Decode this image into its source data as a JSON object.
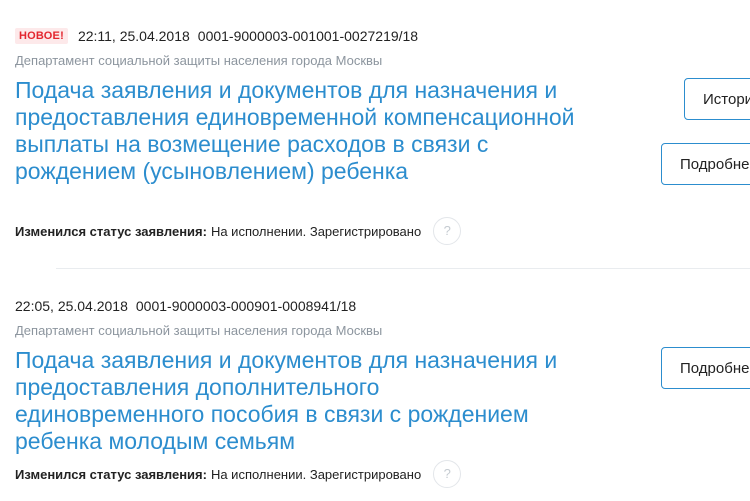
{
  "applications": [
    {
      "badge": "НОВОЕ!",
      "datetime": "22:11, 25.04.2018",
      "number": "0001-9000003-001001-0027219/18",
      "department": "Департамент социальной защиты населения города Москвы",
      "title": "Подача заявления и документов для назначения и предоставления единовременной компенсационной выплаты на возмещение расходов в связи с рождением (усыновлением) ребенка",
      "status_label": "Изменился статус заявления:",
      "status_value": "На исполнении. Зарегистрировано",
      "help_symbol": "?",
      "history_button": "История",
      "details_button": "Подробнее"
    },
    {
      "datetime": "22:05, 25.04.2018",
      "number": "0001-9000003-000901-0008941/18",
      "department": "Департамент социальной защиты населения города Москвы",
      "title": "Подача заявления и документов для назначения и предоставления дополнительного единовременного пособия в связи с рождением ребенка молодым семьям",
      "status_label": "Изменился статус заявления:",
      "status_value": "На исполнении. Зарегистрировано",
      "help_symbol": "?",
      "details_button": "Подробнее"
    }
  ],
  "colors": {
    "link": "#2c8dce",
    "badge_text": "#e3262f",
    "badge_bg": "#fde9ea",
    "muted": "#8c959e"
  }
}
